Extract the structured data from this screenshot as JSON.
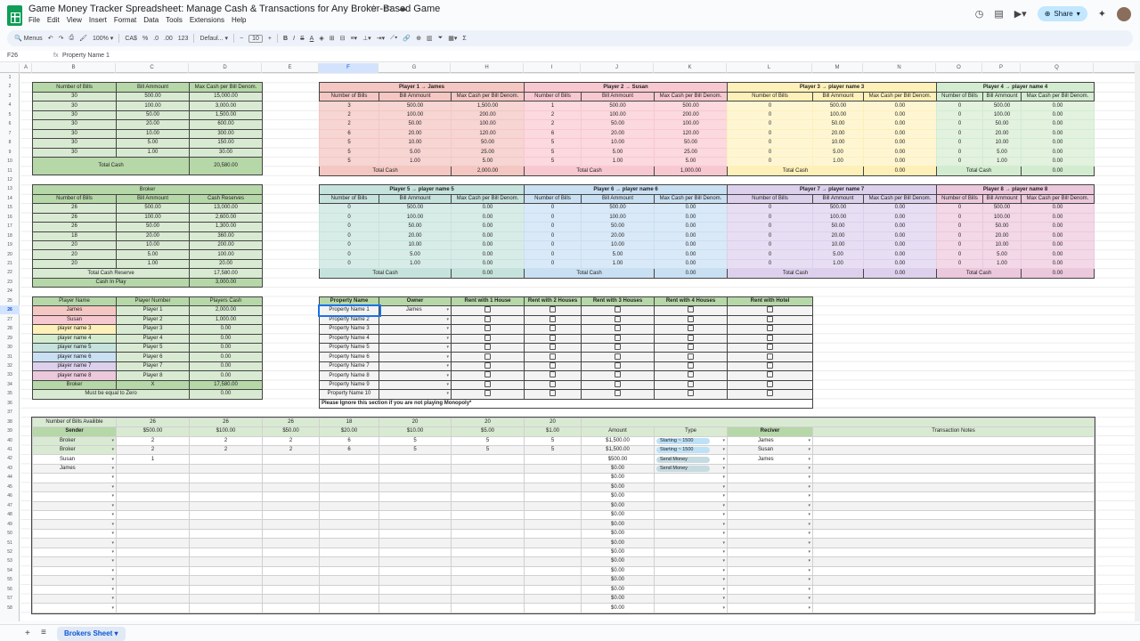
{
  "app": {
    "title": "Game Money Tracker Spreadsheet: Manage Cash & Transactions for Any Broker-Based Game",
    "menu": [
      "File",
      "Edit",
      "View",
      "Insert",
      "Format",
      "Data",
      "Tools",
      "Extensions",
      "Help"
    ],
    "share_label": "Share"
  },
  "toolbar": {
    "search": "Menus",
    "zoom": "100%",
    "currency": "CA$",
    "percent": "%",
    "dec_dec": ".0",
    "inc_dec": ".00",
    "num_fmt": "123",
    "font": "Defaul...",
    "font_size": "10"
  },
  "formula_bar": {
    "name_box": "F26",
    "fx": "fx",
    "value": "Property Name 1"
  },
  "columns": [
    {
      "l": "A",
      "w": 13
    },
    {
      "l": "B",
      "w": 94
    },
    {
      "l": "C",
      "w": 82
    },
    {
      "l": "D",
      "w": 82
    },
    {
      "l": "E",
      "w": 64
    },
    {
      "l": "F",
      "w": 67
    },
    {
      "l": "G",
      "w": 81
    },
    {
      "l": "H",
      "w": 82
    },
    {
      "l": "I",
      "w": 64
    },
    {
      "l": "J",
      "w": 82
    },
    {
      "l": "K",
      "w": 82
    },
    {
      "l": "L",
      "w": 96
    },
    {
      "l": "M",
      "w": 57
    },
    {
      "l": "N",
      "w": 82
    },
    {
      "l": "O",
      "w": 52
    },
    {
      "l": "P",
      "w": 43
    },
    {
      "l": "Q",
      "w": 82
    }
  ],
  "rows": [
    "1",
    "2",
    "3",
    "4",
    "5",
    "6",
    "7",
    "8",
    "9",
    "10",
    "11",
    "12",
    "13",
    "14",
    "15",
    "16",
    "17",
    "18",
    "19",
    "20",
    "21",
    "22",
    "23",
    "24",
    "25",
    "26",
    "27",
    "28",
    "29",
    "30",
    "31",
    "32",
    "33",
    "34",
    "35",
    "36",
    "37",
    "38",
    "39",
    "40",
    "41",
    "42",
    "43",
    "44",
    "45",
    "46",
    "47",
    "48",
    "49",
    "50",
    "51",
    "52",
    "53",
    "54",
    "55",
    "56",
    "57",
    "58"
  ],
  "selected_row": "26",
  "bank": {
    "headers": [
      "Number of Bills",
      "Bill Ammount",
      "Max Cash per Bill Denom."
    ],
    "rows": [
      [
        "30",
        "500.00",
        "15,000.00"
      ],
      [
        "30",
        "100.00",
        "3,000.00"
      ],
      [
        "30",
        "50.00",
        "1,500.00"
      ],
      [
        "30",
        "20.00",
        "600.00"
      ],
      [
        "30",
        "10.00",
        "300.00"
      ],
      [
        "30",
        "5.00",
        "150.00"
      ],
      [
        "30",
        "1.00",
        "30.00"
      ]
    ],
    "total_label": "Total Cash",
    "total": "20,580.00"
  },
  "broker": {
    "title": "Broker",
    "headers": [
      "Number of Bills",
      "Bill Ammount",
      "Cash Reserves"
    ],
    "rows": [
      [
        "26",
        "500.00",
        "13,000.00"
      ],
      [
        "26",
        "100.00",
        "2,600.00"
      ],
      [
        "26",
        "50.00",
        "1,300.00"
      ],
      [
        "18",
        "20.00",
        "360.00"
      ],
      [
        "20",
        "10.00",
        "200.00"
      ],
      [
        "20",
        "5.00",
        "100.00"
      ],
      [
        "20",
        "1.00",
        "20.00"
      ]
    ],
    "reserve_label": "Total Cash Reserve",
    "reserve": "17,580.00",
    "inplay_label": "Cash In Play",
    "inplay": "3,000.00"
  },
  "players_summary": {
    "headers": [
      "Player Name",
      "Player Number",
      "Players Cash"
    ],
    "rows": [
      [
        "James",
        "Player 1",
        "2,000.00"
      ],
      [
        "Susan",
        "Player 2",
        "1,000.00"
      ],
      [
        "player name 3",
        "Player 3",
        "0.00"
      ],
      [
        "player name 4",
        "Player 4",
        "0.00"
      ],
      [
        "player name 5",
        "Player 5",
        "0.00"
      ],
      [
        "player name 6",
        "Player 6",
        "0.00"
      ],
      [
        "player name 7",
        "Player 7",
        "0.00"
      ],
      [
        "player name 8",
        "Player 8",
        "0.00"
      ]
    ],
    "broker_row": [
      "Broker",
      "X",
      "17,580.00"
    ],
    "zero_label": "Must be equal to Zero",
    "zero_val": "0.00"
  },
  "player_blocks": [
    {
      "title": "Player 1 → James",
      "bills": [
        "3",
        "2",
        "2",
        "6",
        "5",
        "5",
        "5"
      ],
      "max": [
        "1,500.00",
        "200.00",
        "100.00",
        "120.00",
        "50.00",
        "25.00",
        "5.00"
      ],
      "total": "2,000.00",
      "bg": "#f4c7c3",
      "row": "#f6d5d2"
    },
    {
      "title": "Player 2 → Susan",
      "bills": [
        "1",
        "2",
        "2",
        "6",
        "5",
        "5",
        "5"
      ],
      "max": [
        "500.00",
        "200.00",
        "100.00",
        "120.00",
        "50.00",
        "25.00",
        "5.00"
      ],
      "total": "1,000.00",
      "bg": "#f8c8d0",
      "row": "#fbd9de"
    },
    {
      "title": "Player 3 → player name 3",
      "bills": [
        "0",
        "0",
        "0",
        "0",
        "0",
        "0",
        "0"
      ],
      "max": [
        "0.00",
        "0.00",
        "0.00",
        "0.00",
        "0.00",
        "0.00",
        "0.00"
      ],
      "total": "0.00",
      "bg": "#fdf0b8",
      "row": "#fef6d3"
    },
    {
      "title": "Player 4 → player name 4",
      "bills": [
        "0",
        "0",
        "0",
        "0",
        "0",
        "0",
        "0"
      ],
      "max": [
        "0.00",
        "0.00",
        "0.00",
        "0.00",
        "0.00",
        "0.00",
        "0.00"
      ],
      "total": "0.00",
      "bg": "#d3ecd0",
      "row": "#e2f2df"
    },
    {
      "title": "Player 5 → player name 5",
      "bills": [
        "0",
        "0",
        "0",
        "0",
        "0",
        "0",
        "0"
      ],
      "max": [
        "0.00",
        "0.00",
        "0.00",
        "0.00",
        "0.00",
        "0.00",
        "0.00"
      ],
      "total": "0.00",
      "bg": "#c6e2dc",
      "row": "#d8ece7"
    },
    {
      "title": "Player 6 → player name 6",
      "bills": [
        "0",
        "0",
        "0",
        "0",
        "0",
        "0",
        "0"
      ],
      "max": [
        "0.00",
        "0.00",
        "0.00",
        "0.00",
        "0.00",
        "0.00",
        "0.00"
      ],
      "total": "0.00",
      "bg": "#c9dff2",
      "row": "#d9e9f7"
    },
    {
      "title": "Player 7 → player name 7",
      "bills": [
        "0",
        "0",
        "0",
        "0",
        "0",
        "0",
        "0"
      ],
      "max": [
        "0.00",
        "0.00",
        "0.00",
        "0.00",
        "0.00",
        "0.00",
        "0.00"
      ],
      "total": "0.00",
      "bg": "#dcd0ec",
      "row": "#e7def3"
    },
    {
      "title": "Player 8 → player name 8",
      "bills": [
        "0",
        "0",
        "0",
        "0",
        "0",
        "0",
        "0"
      ],
      "max": [
        "0.00",
        "0.00",
        "0.00",
        "0.00",
        "0.00",
        "0.00",
        "0.00"
      ],
      "total": "0.00",
      "bg": "#ecc8dc",
      "row": "#f3d8e7"
    }
  ],
  "player_block_headers": [
    "Number of Bills",
    "Bill Ammount",
    "Max Cash per Bill Denom."
  ],
  "denoms": [
    "500.00",
    "100.00",
    "50.00",
    "20.00",
    "10.00",
    "5.00",
    "1.00"
  ],
  "total_cash_label": "Total Cash",
  "property": {
    "headers": [
      "Property Name",
      "Owner",
      "Rent with 1 House",
      "Rent with 2 Houses",
      "Rent with 3 Houses",
      "Rent with 4 Houses",
      "Rent with Hotel"
    ],
    "rows": [
      [
        "Property Name 1",
        "James"
      ],
      [
        "Property Name 2",
        ""
      ],
      [
        "Property Name 3",
        ""
      ],
      [
        "Property Name 4",
        ""
      ],
      [
        "Property Name 5",
        ""
      ],
      [
        "Property Name 6",
        ""
      ],
      [
        "Property Name 7",
        ""
      ],
      [
        "Property Name 8",
        ""
      ],
      [
        "Property Name 9",
        ""
      ],
      [
        "Property Name 10",
        ""
      ]
    ],
    "note": "Please Ignore this section if you are not playing Monopoly*"
  },
  "transactions": {
    "avail_label": "Number of Bills Availible",
    "avail": [
      "26",
      "26",
      "26",
      "18",
      "20",
      "20",
      "20"
    ],
    "denoms": [
      "$500.00",
      "$100.00",
      "$50.00",
      "$20.00",
      "$10.00",
      "$5.00",
      "$1.00"
    ],
    "sender_label": "Sender",
    "amount_label": "Amount",
    "type_label": "Type",
    "receiver_label": "Reciver",
    "notes_label": "Transaction Notes",
    "rows": [
      {
        "sender": "Broker",
        "bills": [
          "2",
          "2",
          "2",
          "6",
          "5",
          "5",
          "5"
        ],
        "amount": "$1,500.00",
        "type": "Starting ~ 1500",
        "receiver": "James"
      },
      {
        "sender": "Broker",
        "bills": [
          "2",
          "2",
          "2",
          "6",
          "5",
          "5",
          "5"
        ],
        "amount": "$1,500.00",
        "type": "Starting ~ 1500",
        "receiver": "Susan"
      },
      {
        "sender": "Susan",
        "bills": [
          "1",
          "",
          "",
          "",
          "",
          "",
          ""
        ],
        "amount": "$500.00",
        "type": "Send Money",
        "receiver": "James"
      },
      {
        "sender": "James",
        "bills": [
          "",
          "",
          "",
          "",
          "",
          "",
          ""
        ],
        "amount": "$0.00",
        "type": "Send Money",
        "receiver": ""
      },
      {
        "sender": "",
        "bills": [
          "",
          "",
          "",
          "",
          "",
          "",
          ""
        ],
        "amount": "$0.00",
        "type": "",
        "receiver": ""
      },
      {
        "sender": "",
        "bills": [
          "",
          "",
          "",
          "",
          "",
          "",
          ""
        ],
        "amount": "$0.00",
        "type": "",
        "receiver": ""
      },
      {
        "sender": "",
        "bills": [
          "",
          "",
          "",
          "",
          "",
          "",
          ""
        ],
        "amount": "$0.00",
        "type": "",
        "receiver": ""
      },
      {
        "sender": "",
        "bills": [
          "",
          "",
          "",
          "",
          "",
          "",
          ""
        ],
        "amount": "$0.00",
        "type": "",
        "receiver": ""
      },
      {
        "sender": "",
        "bills": [
          "",
          "",
          "",
          "",
          "",
          "",
          ""
        ],
        "amount": "$0.00",
        "type": "",
        "receiver": ""
      },
      {
        "sender": "",
        "bills": [
          "",
          "",
          "",
          "",
          "",
          "",
          ""
        ],
        "amount": "$0.00",
        "type": "",
        "receiver": ""
      },
      {
        "sender": "",
        "bills": [
          "",
          "",
          "",
          "",
          "",
          "",
          ""
        ],
        "amount": "$0.00",
        "type": "",
        "receiver": ""
      },
      {
        "sender": "",
        "bills": [
          "",
          "",
          "",
          "",
          "",
          "",
          ""
        ],
        "amount": "$0.00",
        "type": "",
        "receiver": ""
      },
      {
        "sender": "",
        "bills": [
          "",
          "",
          "",
          "",
          "",
          "",
          ""
        ],
        "amount": "$0.00",
        "type": "",
        "receiver": ""
      },
      {
        "sender": "",
        "bills": [
          "",
          "",
          "",
          "",
          "",
          "",
          ""
        ],
        "amount": "$0.00",
        "type": "",
        "receiver": ""
      },
      {
        "sender": "",
        "bills": [
          "",
          "",
          "",
          "",
          "",
          "",
          ""
        ],
        "amount": "$0.00",
        "type": "",
        "receiver": ""
      },
      {
        "sender": "",
        "bills": [
          "",
          "",
          "",
          "",
          "",
          "",
          ""
        ],
        "amount": "$0.00",
        "type": "",
        "receiver": ""
      },
      {
        "sender": "",
        "bills": [
          "",
          "",
          "",
          "",
          "",
          "",
          ""
        ],
        "amount": "$0.00",
        "type": "",
        "receiver": ""
      },
      {
        "sender": "",
        "bills": [
          "",
          "",
          "",
          "",
          "",
          "",
          ""
        ],
        "amount": "$0.00",
        "type": "",
        "receiver": ""
      },
      {
        "sender": "",
        "bills": [
          "",
          "",
          "",
          "",
          "",
          "",
          ""
        ],
        "amount": "$0.00",
        "type": "",
        "receiver": ""
      }
    ]
  },
  "sheet_tab": "Brokers Sheet"
}
